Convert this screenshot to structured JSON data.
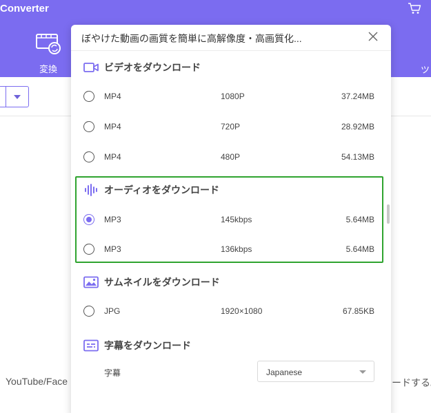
{
  "app": {
    "title": "Converter",
    "nav_convert_label": "変換",
    "nav_right_label": "ツ",
    "bottom_left_text": "YouTube/Face",
    "bottom_right_text": "ードする。"
  },
  "modal": {
    "title": "ぼやけた動画の画質を簡単に高解像度・高画質化...",
    "sections": {
      "video": {
        "title": "ビデオをダウンロード",
        "options": [
          {
            "format": "MP4",
            "quality": "1080P",
            "size": "37.24MB",
            "selected": false
          },
          {
            "format": "MP4",
            "quality": "720P",
            "size": "28.92MB",
            "selected": false
          },
          {
            "format": "MP4",
            "quality": "480P",
            "size": "54.13MB",
            "selected": false
          }
        ]
      },
      "audio": {
        "title": "オーディオをダウンロード",
        "options": [
          {
            "format": "MP3",
            "quality": "145kbps",
            "size": "5.64MB",
            "selected": true
          },
          {
            "format": "MP3",
            "quality": "136kbps",
            "size": "5.64MB",
            "selected": false
          }
        ]
      },
      "thumbnail": {
        "title": "サムネイルをダウンロード",
        "options": [
          {
            "format": "JPG",
            "quality": "1920×1080",
            "size": "67.85KB",
            "selected": false
          }
        ]
      },
      "subtitle": {
        "title": "字幕をダウンロード",
        "field_label": "字幕",
        "selected_language": "Japanese"
      }
    }
  },
  "colors": {
    "accent": "#7b6cf0",
    "highlight": "#2ea32e"
  }
}
